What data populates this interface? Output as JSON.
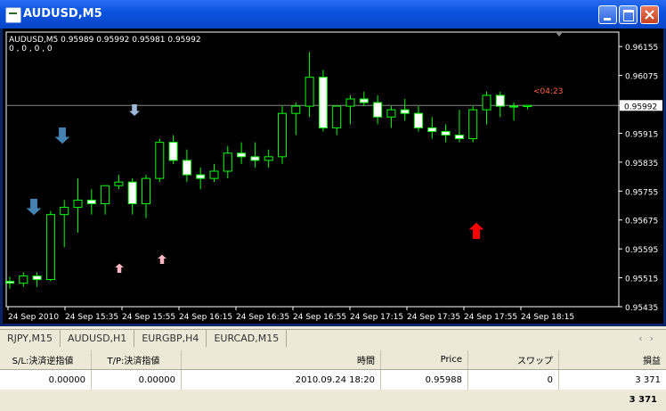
{
  "window": {
    "title": "AUDUSD,M5"
  },
  "chart": {
    "header": "AUDUSD,M5  0.95989 0.95992 0.95981 0.95992",
    "subheader": "0 , 0 , 0 , 0",
    "countdown": "<04:23",
    "price_current": "0.95992",
    "y_labels": [
      "0.96155",
      "0.96075",
      "0.95992",
      "0.95915",
      "0.95835",
      "0.95755",
      "0.95675",
      "0.95595",
      "0.95515",
      "0.95435"
    ],
    "x_labels": [
      "24 Sep 2010",
      "24 Sep 15:35",
      "24 Sep 15:55",
      "24 Sep 16:15",
      "24 Sep 16:35",
      "24 Sep 16:55",
      "24 Sep 17:15",
      "24 Sep 17:35",
      "24 Sep 17:55",
      "24 Sep 18:15"
    ],
    "colors": {
      "bull": "#00ff00",
      "bear_body": "#ffffff",
      "arrow_up_red": "#ff0000",
      "arrow_down_blue": "#4682b4",
      "arrow_pink": "#ffb6c1"
    }
  },
  "chart_data": {
    "type": "candlestick",
    "symbol": "AUDUSD",
    "timeframe": "M5",
    "ylim": [
      0.95435,
      0.96195
    ],
    "candles": [
      [
        0.95505,
        0.95518,
        0.95485,
        0.955
      ],
      [
        0.955,
        0.9553,
        0.9549,
        0.9552
      ],
      [
        0.9552,
        0.9553,
        0.9549,
        0.9551
      ],
      [
        0.9551,
        0.957,
        0.95505,
        0.9569
      ],
      [
        0.9569,
        0.9573,
        0.956,
        0.9571
      ],
      [
        0.9571,
        0.9579,
        0.9564,
        0.9573
      ],
      [
        0.9573,
        0.9576,
        0.9569,
        0.9572
      ],
      [
        0.9572,
        0.9577,
        0.9569,
        0.9577
      ],
      [
        0.9577,
        0.958,
        0.9576,
        0.9578
      ],
      [
        0.9578,
        0.9579,
        0.9569,
        0.9572
      ],
      [
        0.9572,
        0.958,
        0.9568,
        0.9579
      ],
      [
        0.9579,
        0.959,
        0.9578,
        0.9589
      ],
      [
        0.9589,
        0.9591,
        0.9583,
        0.9584
      ],
      [
        0.9584,
        0.9587,
        0.9578,
        0.958
      ],
      [
        0.958,
        0.9582,
        0.9576,
        0.9579
      ],
      [
        0.9579,
        0.9583,
        0.9578,
        0.9581
      ],
      [
        0.9581,
        0.9588,
        0.9579,
        0.9586
      ],
      [
        0.9586,
        0.9589,
        0.9583,
        0.9585
      ],
      [
        0.9585,
        0.9589,
        0.9582,
        0.9584
      ],
      [
        0.9584,
        0.9587,
        0.9582,
        0.9585
      ],
      [
        0.9585,
        0.9599,
        0.9583,
        0.9597
      ],
      [
        0.9597,
        0.96,
        0.9591,
        0.9599
      ],
      [
        0.9599,
        0.9614,
        0.9596,
        0.9607
      ],
      [
        0.9607,
        0.9609,
        0.9592,
        0.9593
      ],
      [
        0.9593,
        0.9599,
        0.9591,
        0.9599
      ],
      [
        0.9599,
        0.9602,
        0.9594,
        0.9601
      ],
      [
        0.9601,
        0.9603,
        0.9599,
        0.96
      ],
      [
        0.96,
        0.9602,
        0.9594,
        0.9596
      ],
      [
        0.9596,
        0.9599,
        0.9593,
        0.9598
      ],
      [
        0.9598,
        0.9601,
        0.9595,
        0.9597
      ],
      [
        0.9597,
        0.9599,
        0.9592,
        0.9593
      ],
      [
        0.9593,
        0.9596,
        0.959,
        0.9592
      ],
      [
        0.9592,
        0.9594,
        0.9589,
        0.9591
      ],
      [
        0.9591,
        0.9598,
        0.9589,
        0.959
      ],
      [
        0.959,
        0.9599,
        0.9589,
        0.9598
      ],
      [
        0.9598,
        0.9603,
        0.9594,
        0.9602
      ],
      [
        0.9602,
        0.9603,
        0.9596,
        0.9599
      ],
      [
        0.9599,
        0.96,
        0.9595,
        0.9599
      ],
      [
        0.95989,
        0.95992,
        0.95981,
        0.95992
      ]
    ]
  },
  "tabs": [
    "RJPY,M15",
    "AUDUSD,H1",
    "EURGBP,H4",
    "EURCAD,M15"
  ],
  "terminal": {
    "headers": [
      "S/L:決済逆指値",
      "T/P:決済指値",
      "時間",
      "Price",
      "スワップ",
      "損益"
    ],
    "row": [
      "0.00000",
      "0.00000",
      "2010.09.24 18:20",
      "0.95988",
      "0",
      "3 371"
    ],
    "total": "3 371"
  }
}
